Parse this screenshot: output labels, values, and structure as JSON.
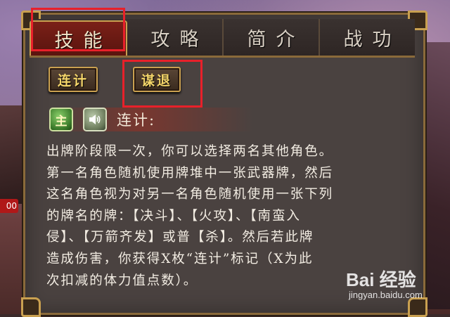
{
  "tabs": [
    {
      "label": "技能",
      "active": true
    },
    {
      "label": "攻略",
      "active": false
    },
    {
      "label": "简介",
      "active": false
    },
    {
      "label": "战功",
      "active": false
    }
  ],
  "sub_buttons": [
    {
      "label": "连计"
    },
    {
      "label": "谋退"
    }
  ],
  "side_badge": "00",
  "skill": {
    "type_icon": "主",
    "speaker_icon": "speaker-icon",
    "name": "连计:",
    "description": "出牌阶段限一次，你可以选择两名其他角色。\n第一名角色随机使用牌堆中一张武器牌，然后\n这名角色视为对另一名角色随机使用一张下列\n的牌名的牌：【决斗】、【火攻】、【南蛮入\n侵】、【万箭齐发】或普【杀】。然后若此牌\n造成伤害，你获得X枚“连计”标记（X为此\n次扣减的体力值点数）。"
  },
  "watermark": {
    "main": "Bai 经验",
    "url": "jingyan.baidu.com"
  },
  "colors": {
    "highlight": "#e8202a",
    "gold_border": "#c9a050",
    "active_tab": "#7a2018",
    "button_text": "#f5d66a"
  }
}
